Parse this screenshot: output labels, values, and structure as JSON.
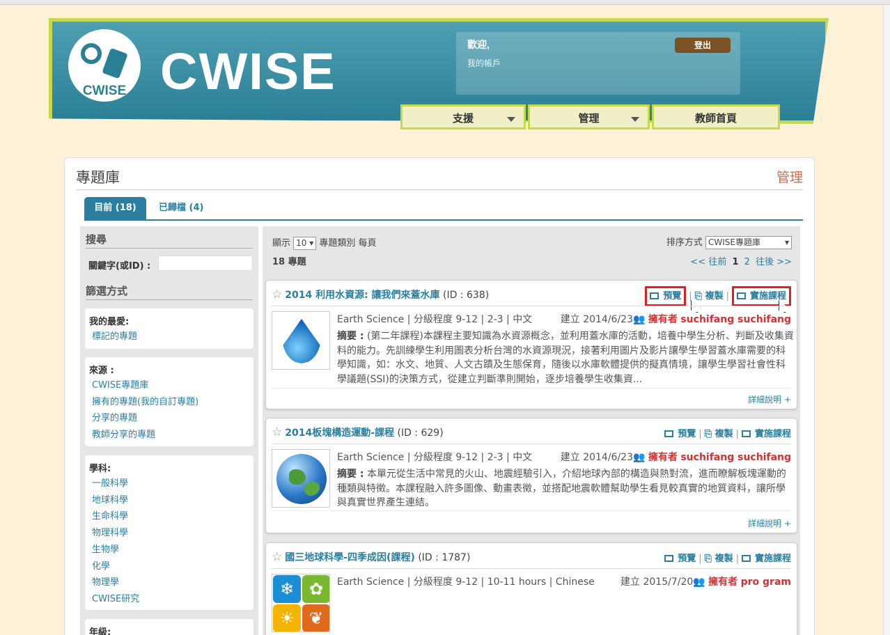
{
  "header": {
    "logo_text": "CWISE",
    "brand": "CWISE",
    "welcome": "歡迎,",
    "account": "我的帳戶",
    "logout": "登出",
    "nav": [
      {
        "label": "支援",
        "dropdown": true
      },
      {
        "label": "管理",
        "dropdown": true
      },
      {
        "label": "教師首頁",
        "dropdown": false
      }
    ]
  },
  "panel": {
    "title": "專題庫",
    "manage": "管理",
    "tabs": [
      {
        "label": "目前 (18)",
        "active": true
      },
      {
        "label": "已歸檔 (4)",
        "active": false
      }
    ]
  },
  "sidebar": {
    "search_heading": "搜尋",
    "keyword_label": "關鍵字(或ID) :",
    "filter_heading": "篩選方式",
    "favorites": {
      "heading": "我的最愛:",
      "items": [
        "標記的專題"
      ]
    },
    "source": {
      "heading": "來源 :",
      "items": [
        "CWISE專題庫",
        "擁有的專題(我的自訂專題)",
        "分享的專題",
        "教師分享的專題"
      ]
    },
    "subject": {
      "heading": "學科:",
      "items": [
        "一般科學",
        "地球科學",
        "生命科學",
        "物理科學",
        "生物學",
        "化學",
        "物理學",
        "CWISE研究"
      ]
    },
    "grade": {
      "heading": "年級:"
    }
  },
  "list": {
    "show_label": "顯示",
    "per_page": "10",
    "per_page_suffix": "專題類別 每頁",
    "total": "18 專題",
    "sort_label": "排序方式",
    "sort_value": "CWISE專題庫",
    "pager_prev": "<< 往前",
    "pager_current": "1",
    "pager_next_page": "2",
    "pager_next": "往後 >>",
    "actions": {
      "preview": "預覽",
      "copy": "複製",
      "run": "實施課程"
    },
    "more": "詳細說明 +",
    "abstract_label": "摘要 :",
    "id_label": "(ID :",
    "created_label": "建立",
    "owner_label": "擁有者",
    "projects": [
      {
        "title": "2014 利用水資源: 讓我們來蓋水庫",
        "id": "638",
        "meta": "Earth Science | 分級程度 9-12 | 2-3 | 中文",
        "created": "2014/6/23",
        "owner": "suchifang suchifang",
        "thumb": "water-drop",
        "abstract": "(第二年課程)本課程主要知識為水資源概念，並利用蓋水庫的活動，培養中學生分析、判斷及收集資料的能力。先訓練學生利用圖表分析台灣的水資源現況，接著利用圖片及影片讓學生學習蓋水庫需要的科學知識，如：水文、地質、人文古蹟及生態保育，隨後以水庫軟體提供的擬真情境，讓學生學習社會性科學議題(SSI)的決策方式，從建立判斷準則開始，逐步培養學生收集資..."
      },
      {
        "title": "2014板塊構造運動-課程",
        "id": "629",
        "meta": "Earth Science | 分級程度 9-12 | 2-3 | 中文",
        "created": "2014/6/23",
        "owner": "suchifang suchifang",
        "thumb": "globe",
        "abstract": "本單元從生活中常見的火山、地震經驗引入，介紹地球內部的構造與熱對流，進而瞭解板塊運動的種類與特徵。本課程融入許多圖像、動畫表徵，並搭配地震軟體幫助學生看見較真實的地質資料，讓所學與真實世界產生連結。"
      },
      {
        "title": "國三地球科學-四季成因(課程)",
        "id": "1787",
        "meta": "Earth Science | 分級程度 9-12 | 10-11 hours | Chinese",
        "created": "2015/7/20",
        "owner": "pro gram",
        "thumb": "four-seasons",
        "abstract": ""
      }
    ]
  },
  "colors": {
    "accent": "#2a7fa0",
    "banner": "#2b7f95",
    "lime": "#c5d94a",
    "owner": "#d83030",
    "highlight": "#e02020"
  }
}
